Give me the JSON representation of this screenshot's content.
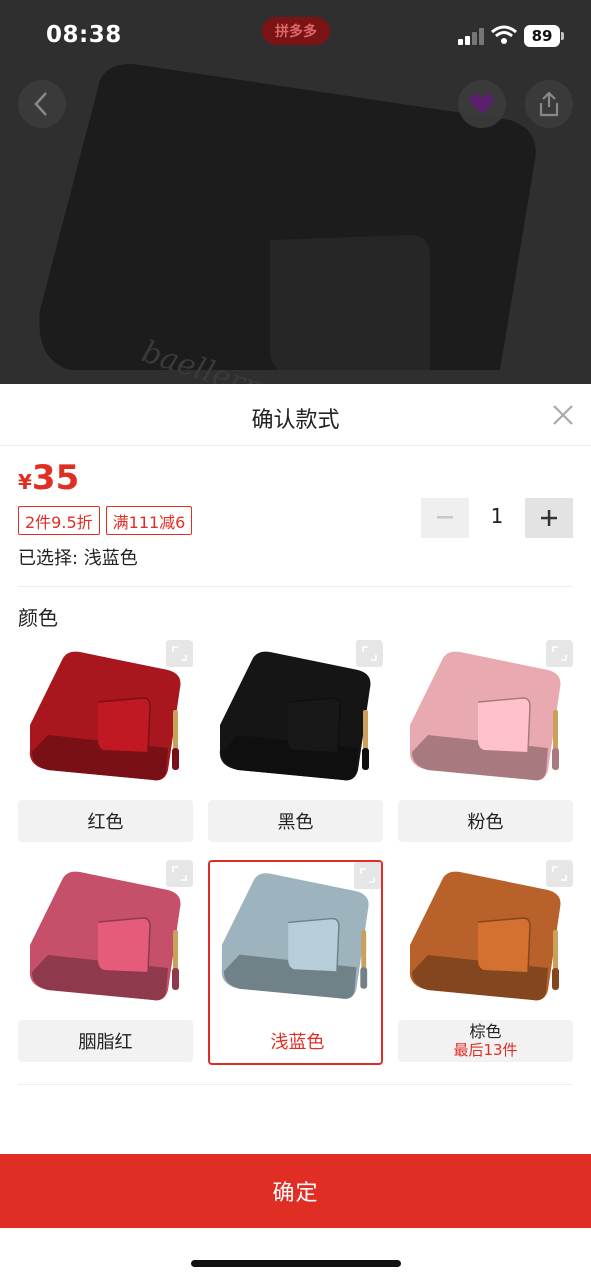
{
  "status_bar": {
    "time": "08:38",
    "battery": "89",
    "brand": "拼多多"
  },
  "sheet": {
    "title": "确认款式",
    "price_symbol": "¥",
    "price": "35",
    "promo_tags": [
      "2件9.5折",
      "满111减6"
    ],
    "selected_text": "已选择: 浅蓝色",
    "quantity": "1",
    "color_section_label": "颜色",
    "options": [
      {
        "label": "红色",
        "color": "#a8161e",
        "note": ""
      },
      {
        "label": "黑色",
        "color": "#151515",
        "note": ""
      },
      {
        "label": "粉色",
        "color": "#e9a9b0",
        "note": ""
      },
      {
        "label": "胭脂红",
        "color": "#c6506a",
        "note": ""
      },
      {
        "label": "浅蓝色",
        "color": "#9db3bd",
        "note": "",
        "selected": true
      },
      {
        "label": "棕色",
        "color": "#b8612a",
        "note": "最后13件"
      }
    ],
    "confirm_label": "确定"
  },
  "colors": {
    "accent": "#e02e24"
  }
}
